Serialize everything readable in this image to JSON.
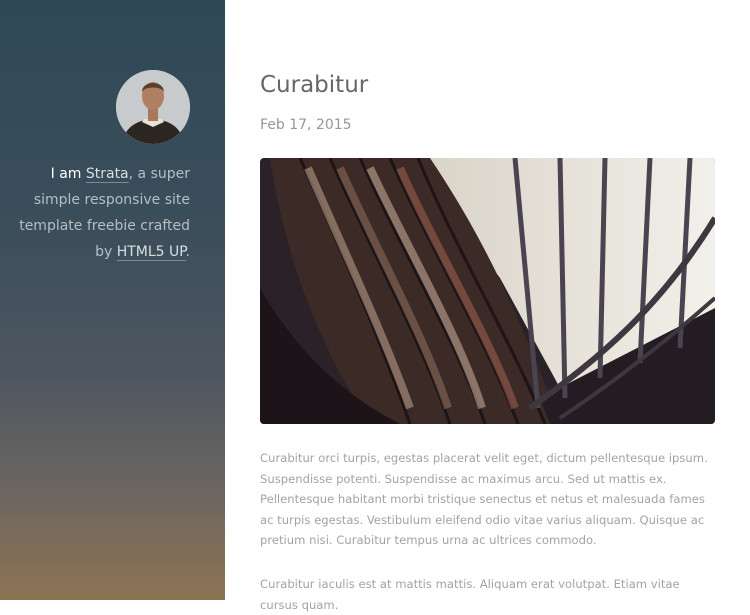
{
  "sidebar": {
    "intro": {
      "prefix": "I am",
      "name_link": "Strata",
      "middle": ", a super simple responsive site template freebie crafted by",
      "author_link": "HTML5 UP",
      "suffix": "."
    }
  },
  "post": {
    "title": "Curabitur",
    "date": "Feb 17, 2015",
    "paragraphs": [
      "Curabitur orci turpis, egestas placerat velit eget, dictum pellentesque ipsum. Suspendisse potenti. Suspendisse ac maximus arcu. Sed ut mattis ex. Pellentesque habitant morbi tristique senectus et netus et malesuada fames ac turpis egestas. Vestibulum eleifend odio vitae varius aliquam. Quisque ac pretium nisi. Curabitur tempus urna ac ultrices commodo.",
      "Curabitur iaculis est at mattis mattis. Aliquam erat volutpat. Etiam vitae cursus quam."
    ]
  },
  "colors": {
    "sidebar_top": "#2f4957",
    "sidebar_bottom": "#8c7453",
    "title_text": "#676767",
    "body_text": "#a3a3a3"
  }
}
